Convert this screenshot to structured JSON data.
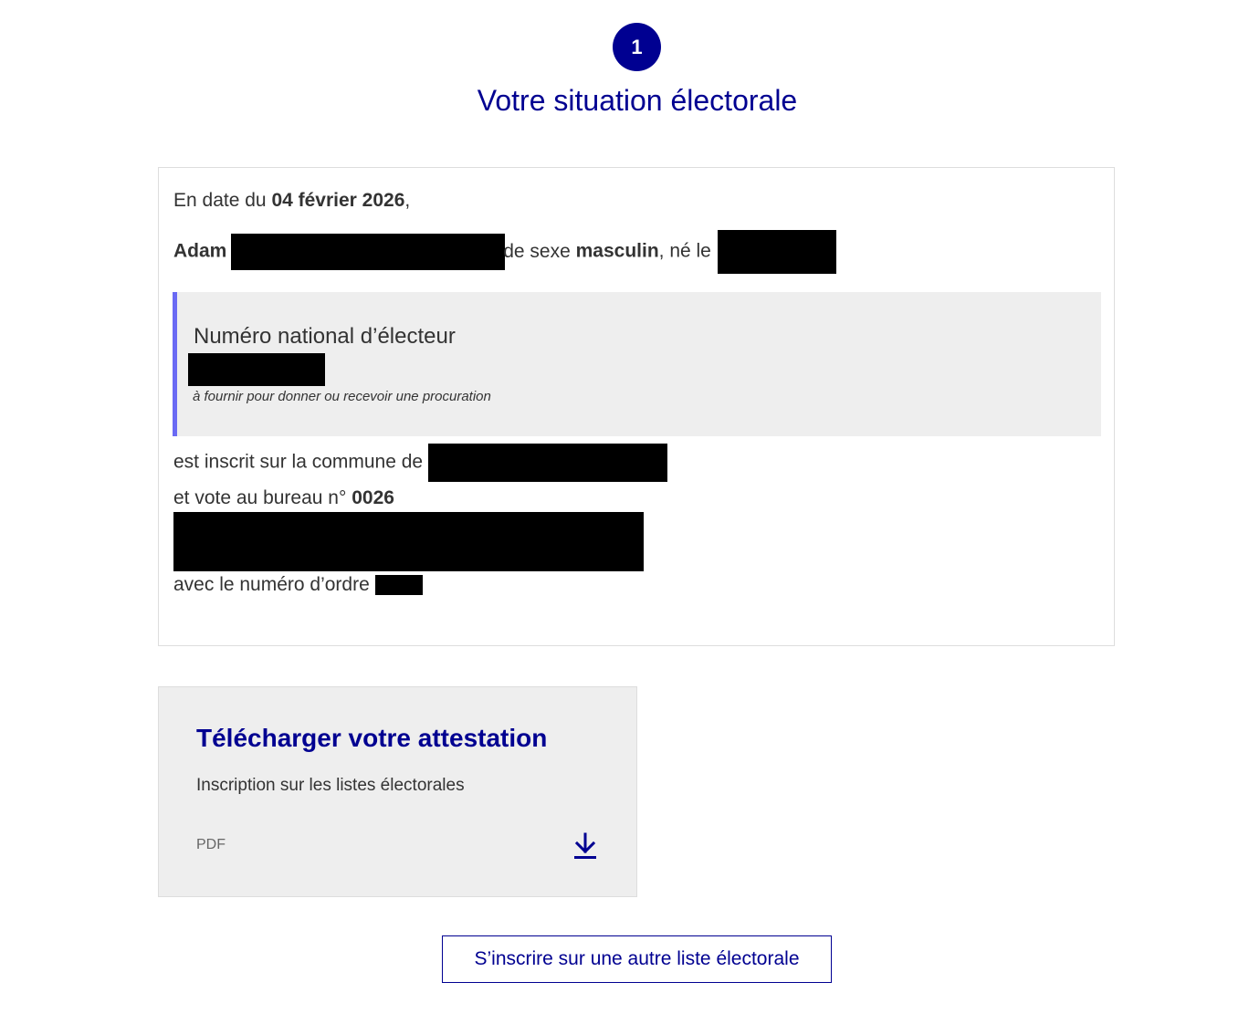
{
  "step": {
    "number": "1",
    "title": "Votre situation électorale"
  },
  "situation": {
    "date_prefix": "En date du",
    "date_value": "04 février 2026",
    "date_suffix": ",",
    "first_name": "Adam",
    "sex_prefix": "de sexe",
    "sex_value": "masculin",
    "birth_prefix": ", né le",
    "nne": {
      "title": "Numéro national d’électeur",
      "note": "à fournir pour donner ou recevoir une procuration"
    },
    "commune_text": "est inscrit sur la commune de",
    "bureau_text": "et vote au bureau n°",
    "bureau_number": "0026",
    "ordre_text": "avec le numéro d’ordre"
  },
  "download": {
    "title": "Télécharger votre attestation",
    "description": "Inscription sur les listes électorales",
    "format": "PDF",
    "icon": "download-icon"
  },
  "actions": {
    "other_list_label": "S’inscrire sur une autre liste électorale"
  },
  "colors": {
    "primary": "#000091",
    "accent_border": "#6a6af4",
    "grey_bg": "#eeeeee"
  }
}
